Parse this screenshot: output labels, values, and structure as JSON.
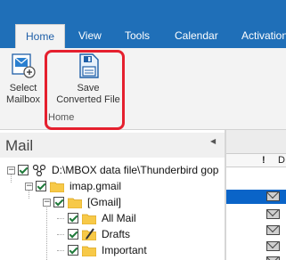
{
  "ribbon": {
    "tabs": [
      {
        "label": "Home",
        "active": true
      },
      {
        "label": "View"
      },
      {
        "label": "Tools"
      },
      {
        "label": "Calendar"
      },
      {
        "label": "Activation"
      }
    ],
    "buttons": {
      "select_mailbox": "Select\nMailbox",
      "save_converted_file": "Save\nConverted File"
    },
    "group_label": "Home",
    "highlight_color": "#e5202e",
    "tab_bar_color": "#1f6fb8"
  },
  "mail_pane": {
    "title": "Mail",
    "collapse_icon": "chevron-left-icon",
    "tree": [
      {
        "label": "D:\\MBOX data file\\Thunderbird gop",
        "icon": "network-root-icon",
        "expander": "−",
        "checked": true
      },
      {
        "label": "imap.gmail",
        "icon": "folder-icon",
        "expander": "−",
        "checked": true
      },
      {
        "label": "[Gmail]",
        "icon": "folder-icon",
        "expander": "−",
        "checked": true
      },
      {
        "label": "All Mail",
        "icon": "folder-icon",
        "checked": true
      },
      {
        "label": "Drafts",
        "icon": "drafts-folder-icon",
        "checked": true
      },
      {
        "label": "Important",
        "icon": "folder-icon",
        "checked": true
      }
    ]
  },
  "message_list": {
    "columns": [
      "!",
      "D"
    ],
    "rows": 5,
    "selected_row": 1,
    "selection_color": "#0a64c8"
  }
}
